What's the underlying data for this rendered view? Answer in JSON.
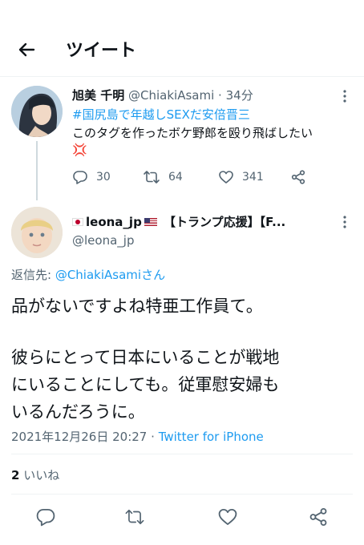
{
  "header": {
    "title": "ツイート"
  },
  "parent_tweet": {
    "name": "旭美 千明",
    "handle": "@ChiakiAsami",
    "dot": "·",
    "time": "34分",
    "hashtag": "#国尻島で年越しSEXだ安倍晋三",
    "text": "このタグを作ったボケ野郎を殴り飛ばしたい",
    "emoji": "💢",
    "reply_count": "30",
    "retweet_count": "64",
    "like_count": "341"
  },
  "main_tweet": {
    "name_start": "leona_jp",
    "name_end": "【トランプ応援】【F...",
    "handle": "@leona_jp",
    "reply_label": "返信先: ",
    "reply_target": "@ChiakiAsamiさん",
    "lines": [
      "品がないですよね特亜工作員て。",
      "",
      "彼らにとって日本にいることが戦地",
      "にいることにしても。従軍慰安婦も",
      "いるんだろうに。"
    ],
    "timestamp": "2021年12月26日 20:27",
    "dot": "·",
    "source": "Twitter for iPhone",
    "likes_count": "2",
    "likes_label": "いいね"
  },
  "colors": {
    "accent": "#1d9bf0",
    "text": "#0f1419",
    "muted": "#536471",
    "divider": "#eff3f4"
  },
  "icons": [
    "back-arrow-icon",
    "more-icon",
    "reply-icon",
    "retweet-icon",
    "like-icon",
    "share-icon"
  ]
}
